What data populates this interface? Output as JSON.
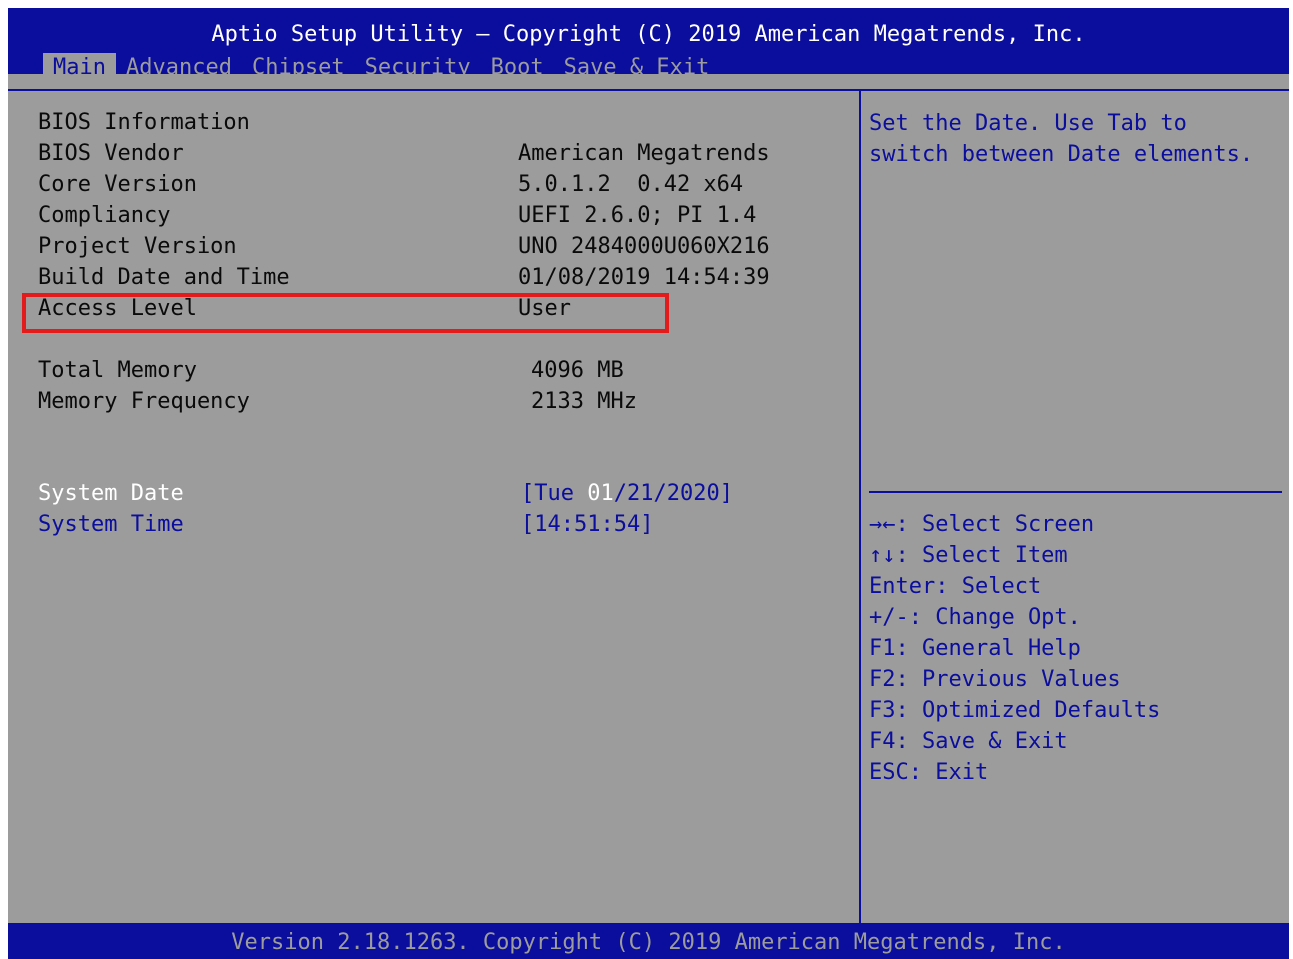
{
  "header": {
    "title": "Aptio Setup Utility – Copyright (C) 2019 American Megatrends, Inc.",
    "tabs": [
      {
        "label": "Main",
        "active": true
      },
      {
        "label": "Advanced",
        "active": false
      },
      {
        "label": "Chipset",
        "active": false
      },
      {
        "label": "Security",
        "active": false
      },
      {
        "label": "Boot",
        "active": false
      },
      {
        "label": "Save & Exit",
        "active": false
      }
    ]
  },
  "main": {
    "section_title": "BIOS Information",
    "info": [
      {
        "label": "BIOS Vendor",
        "value": "American Megatrends"
      },
      {
        "label": "Core Version",
        "value": "5.0.1.2  0.42 x64"
      },
      {
        "label": "Compliancy",
        "value": "UEFI 2.6.0; PI 1.4"
      },
      {
        "label": "Project Version",
        "value": "UNO 2484000U060X216"
      },
      {
        "label": "Build Date and Time",
        "value": "01/08/2019 14:54:39"
      },
      {
        "label": "Access Level",
        "value": "User"
      }
    ],
    "memory": [
      {
        "label": "Total Memory",
        "value": "4096 MB"
      },
      {
        "label": "Memory Frequency",
        "value": "2133 MHz"
      }
    ],
    "system_date": {
      "label": "System Date",
      "value_prefix": "[Tue ",
      "value_selected": "01",
      "value_suffix": "/21/2020]"
    },
    "system_time": {
      "label": "System Time",
      "value": "[14:51:54]"
    }
  },
  "help": {
    "line1": "Set the Date. Use Tab to",
    "line2": "switch between Date elements.",
    "keys": [
      "→←: Select Screen",
      "↑↓: Select Item",
      "Enter: Select",
      "+/-: Change Opt.",
      "F1: General Help",
      "F2: Previous Values",
      "F3: Optimized Defaults",
      "F4: Save & Exit",
      "ESC: Exit"
    ]
  },
  "footer": {
    "text": "Version 2.18.1263. Copyright (C) 2019 American Megatrends, Inc."
  },
  "colors": {
    "bios_blue": "#0b0d9c",
    "panel_gray": "#9c9c9c",
    "highlight_red": "#e31b1b",
    "selected_white": "#ffffff"
  }
}
